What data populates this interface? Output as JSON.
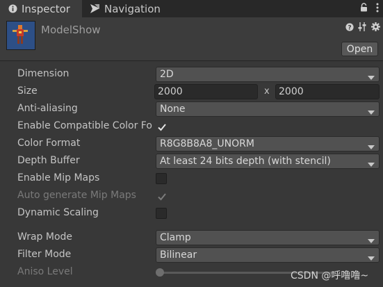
{
  "tabs": {
    "inspector_label": "Inspector",
    "navigation_label": "Navigation"
  },
  "header": {
    "object_name": "ModelShow",
    "open_label": "Open"
  },
  "properties": {
    "dimension": {
      "label": "Dimension",
      "value": "2D"
    },
    "size": {
      "label": "Size",
      "width": "2000",
      "x": "x",
      "height": "2000"
    },
    "anti_aliasing": {
      "label": "Anti-aliasing",
      "value": "None"
    },
    "compatible_color_format": {
      "label": "Enable Compatible Color Fo",
      "checked": true
    },
    "color_format": {
      "label": "Color Format",
      "value": "R8G8B8A8_UNORM"
    },
    "depth_buffer": {
      "label": "Depth Buffer",
      "value": "At least 24 bits depth (with stencil)"
    },
    "enable_mip_maps": {
      "label": "Enable Mip Maps",
      "checked": false
    },
    "auto_generate_mip_maps": {
      "label": "Auto generate Mip Maps",
      "checked": true,
      "disabled": true
    },
    "dynamic_scaling": {
      "label": "Dynamic Scaling",
      "checked": false
    },
    "wrap_mode": {
      "label": "Wrap Mode",
      "value": "Clamp"
    },
    "filter_mode": {
      "label": "Filter Mode",
      "value": "Bilinear"
    },
    "aniso_level": {
      "label": "Aniso Level",
      "disabled": true
    }
  },
  "watermark": "CSDN @呼噜噜~",
  "icons": {
    "inspector_tab": "info-icon",
    "navigation_tab": "navigation-icon",
    "lock": "lock-icon",
    "menu": "kebab-menu-icon",
    "help": "help-icon",
    "presets": "sliders-icon",
    "settings": "gear-icon",
    "dropdown": "chevron-down-icon"
  },
  "colors": {
    "panel_bg": "#383838",
    "tab_bg": "#282828",
    "header_bg": "#3c3c3c",
    "thumbnail_bg": "#2d4f86"
  }
}
